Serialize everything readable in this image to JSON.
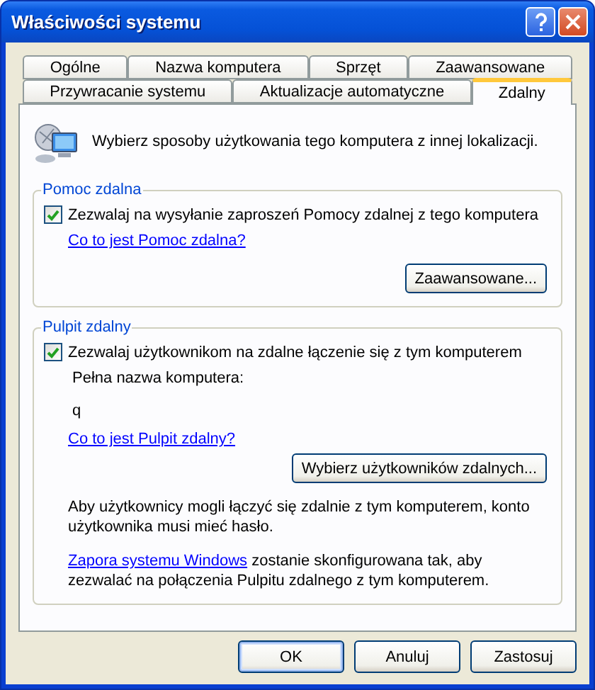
{
  "window": {
    "title": "Właściwości systemu"
  },
  "tab_rows": [
    [
      {
        "label": "Ogólne",
        "selected": false
      },
      {
        "label": "Nazwa komputera",
        "selected": false
      },
      {
        "label": "Sprzęt",
        "selected": false
      },
      {
        "label": "Zaawansowane",
        "selected": false
      }
    ],
    [
      {
        "label": "Przywracanie systemu",
        "selected": false
      },
      {
        "label": "Aktualizacje automatyczne",
        "selected": false
      },
      {
        "label": "Zdalny",
        "selected": true
      }
    ]
  ],
  "intro": "Wybierz sposoby użytkowania tego komputera z innej lokalizacji.",
  "remote_assistance": {
    "title": "Pomoc zdalna",
    "checkbox": {
      "label": "Zezwalaj na wysyłanie zaproszeń Pomocy zdalnej z tego komputera",
      "checked": true
    },
    "link": "Co to jest Pomoc zdalna?",
    "button": "Zaawansowane..."
  },
  "remote_desktop": {
    "title": "Pulpit zdalny",
    "checkbox": {
      "label": "Zezwalaj użytkownikom na zdalne łączenie się z tym komputerem",
      "checked": true
    },
    "computer_name_label": "Pełna nazwa komputera:",
    "computer_name": "q",
    "link": "Co to jest Pulpit zdalny?",
    "button": "Wybierz użytkowników zdalnych...",
    "password_note": "Aby użytkownicy mogli łączyć się zdalnie z tym komputerem, konto użytkownika musi mieć hasło.",
    "firewall_link": "Zapora systemu Windows",
    "firewall_note": " zostanie skonfigurowana tak, aby zezwalać na połączenia Pulpitu zdalnego z tym komputerem."
  },
  "buttons": [
    "OK",
    "Anuluj",
    "Zastosuj"
  ]
}
